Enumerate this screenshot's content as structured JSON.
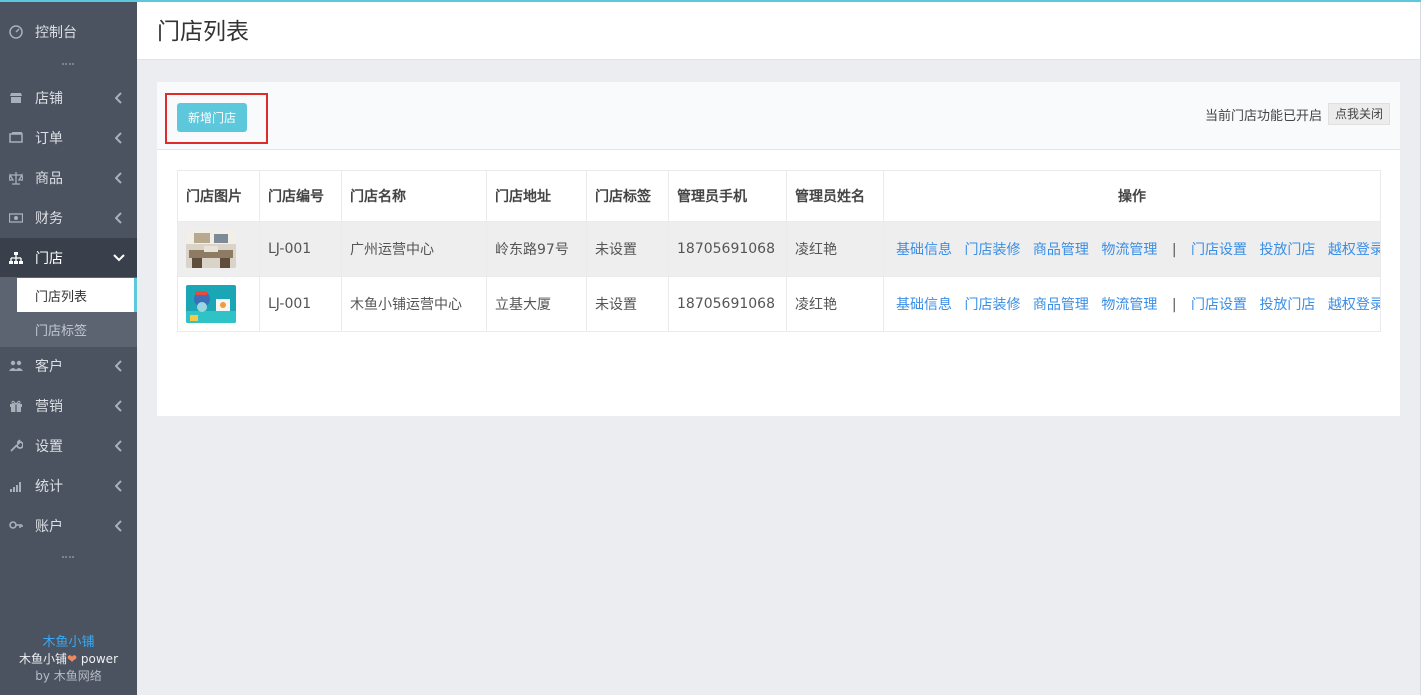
{
  "sidebar": {
    "items": [
      {
        "label": "控制台",
        "icon": "dashboard-icon"
      },
      {
        "label": "店铺",
        "icon": "shop-icon"
      },
      {
        "label": "订单",
        "icon": "order-icon"
      },
      {
        "label": "商品",
        "icon": "scale-icon"
      },
      {
        "label": "财务",
        "icon": "money-icon"
      },
      {
        "label": "门店",
        "icon": "sitemap-icon"
      },
      {
        "label": "客户",
        "icon": "users-icon"
      },
      {
        "label": "营销",
        "icon": "gift-icon"
      },
      {
        "label": "设置",
        "icon": "wrench-icon"
      },
      {
        "label": "统计",
        "icon": "signal-icon"
      },
      {
        "label": "账户",
        "icon": "key-icon"
      }
    ],
    "sub_items": [
      "门店列表",
      "门店标签"
    ],
    "footer": {
      "brand": "木鱼小铺",
      "power_name": "木鱼小铺",
      "power_word": "power",
      "by": "by 木鱼网络"
    }
  },
  "header": {
    "title": "门店列表"
  },
  "toolbar": {
    "add_label": "新增门店",
    "status_text": "当前门店功能已开启",
    "close_label": "点我关闭"
  },
  "table": {
    "columns": [
      "门店图片",
      "门店编号",
      "门店名称",
      "门店地址",
      "门店标签",
      "管理员手机",
      "管理员姓名",
      "操作"
    ],
    "rows": [
      {
        "code": "LJ-001",
        "name": "广州运营中心",
        "address": "岭东路97号",
        "tag": "未设置",
        "phone": "18705691068",
        "admin": "凌红艳"
      },
      {
        "code": "LJ-001",
        "name": "木鱼小铺运营中心",
        "address": "立基大厦",
        "tag": "未设置",
        "phone": "18705691068",
        "admin": "凌红艳"
      }
    ],
    "actions": [
      "基础信息",
      "门店装修",
      "商品管理",
      "物流管理",
      "|",
      "门店设置",
      "投放门店",
      "越权登录"
    ]
  },
  "colors": {
    "accent": "#5dc8dc",
    "sidebar_bg": "#4b5361",
    "link": "#3a8ee6",
    "highlight": "#e02b2b"
  }
}
